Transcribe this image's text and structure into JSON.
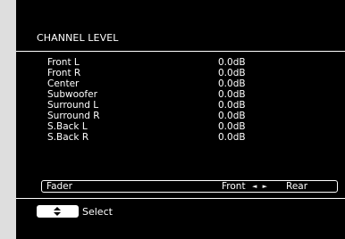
{
  "screen": {
    "title": "CHANNEL LEVEL"
  },
  "channels": [
    {
      "label": "Front L",
      "value": "0.0dB"
    },
    {
      "label": "Front R",
      "value": "0.0dB"
    },
    {
      "label": "Center",
      "value": "0.0dB"
    },
    {
      "label": "Subwoofer",
      "value": "0.0dB"
    },
    {
      "label": "Surround L",
      "value": "0.0dB"
    },
    {
      "label": "Surround R",
      "value": "0.0dB"
    },
    {
      "label": "S.Back L",
      "value": "0.0dB"
    },
    {
      "label": "S.Back R",
      "value": "0.0dB"
    }
  ],
  "fader": {
    "label": "Fader",
    "left_option": "Front",
    "arrows": "◄ ►",
    "right_option": "Rear"
  },
  "footer": {
    "select_icon": "up-down-arrow-icon",
    "select_label": "Select"
  },
  "colors": {
    "background": "#000000",
    "text": "#ffffff",
    "border": "#dedede"
  }
}
